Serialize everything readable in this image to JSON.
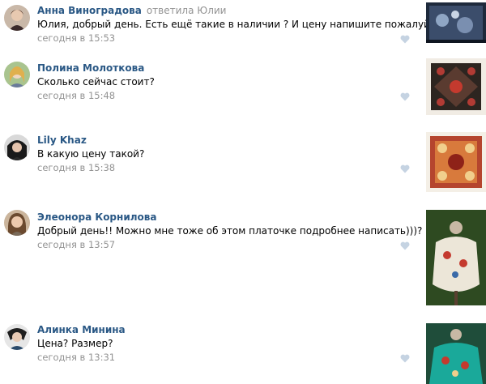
{
  "comments": [
    {
      "author": "Анна Виноградова",
      "reply_to": "ответила Юлии",
      "text": "Юлия, добрый день. Есть ещё такие в наличии ? И цену напишите пожалуйста.",
      "time": "сегодня в 15:53",
      "like_icon": "heart-icon"
    },
    {
      "author": "Полина Молоткова",
      "text": "Сколько сейчас стоит?",
      "time": "сегодня в 15:48",
      "like_icon": "heart-icon"
    },
    {
      "author": "Lily Khaz",
      "text": "В какую цену такой?",
      "time": "сегодня в 15:38",
      "like_icon": "heart-icon"
    },
    {
      "author": "Элеонора Корнилова",
      "text": "Добрый день!! Можно мне тоже об этом платочке подробнее написать)))?",
      "time": "сегодня в 13:57",
      "like_icon": "heart-icon"
    },
    {
      "author": "Алинка Минина",
      "text": "Цена? Размер?",
      "time": "сегодня в 13:31",
      "like_icon": "heart-icon"
    }
  ],
  "colors": {
    "author_link": "#2a5885",
    "meta_gray": "#939393",
    "heart": "#c5d3e2"
  }
}
